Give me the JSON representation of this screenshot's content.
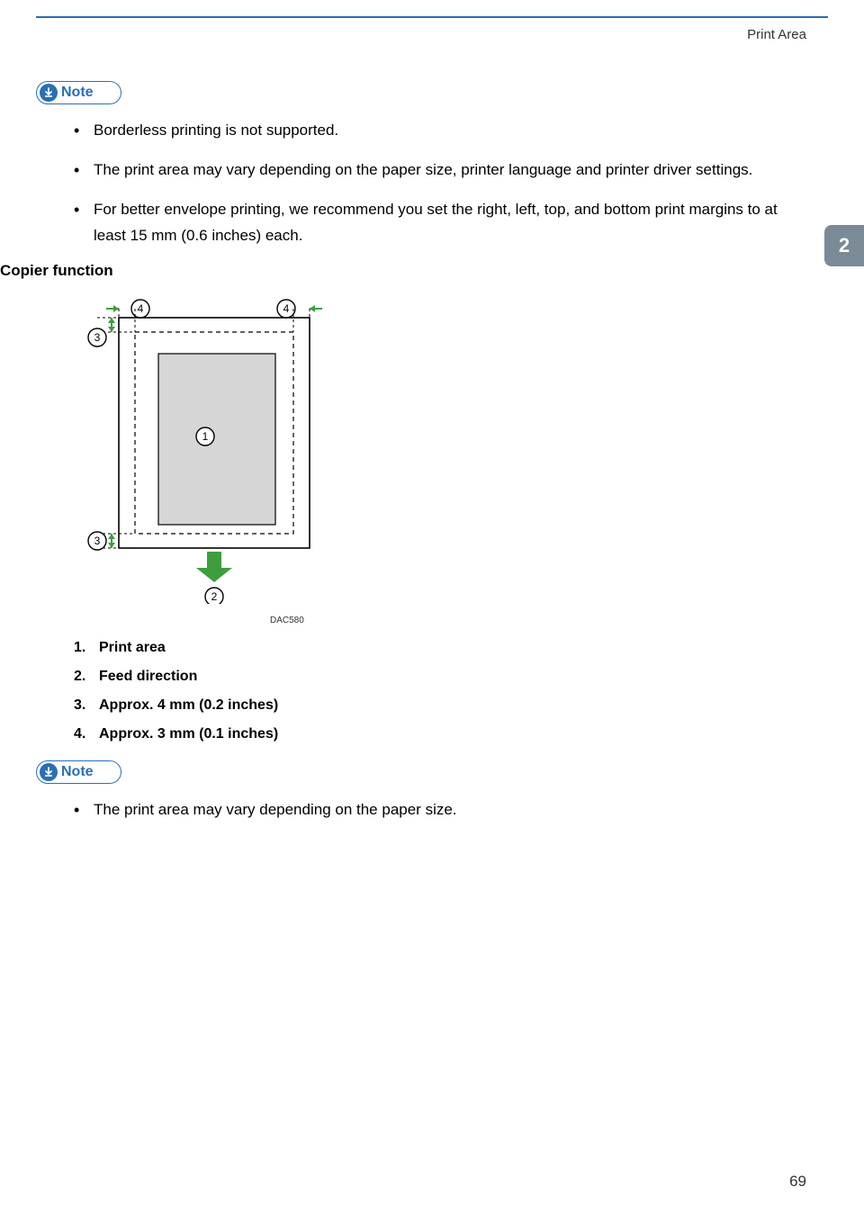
{
  "header": {
    "title": "Print Area"
  },
  "tab": {
    "label": "2"
  },
  "note_label": "Note",
  "notes_top": [
    "Borderless printing is not supported.",
    "The print area may vary depending on the paper size, printer language and printer driver settings.",
    "For better envelope printing, we recommend you set the right, left, top, and bottom print margins to at least 15 mm (0.6 inches) each."
  ],
  "section_heading": "Copier function",
  "diagram": {
    "code": "DAC580",
    "callouts": {
      "c1": "1",
      "c2": "2",
      "c3": "3",
      "c4": "4"
    }
  },
  "legend": [
    "Print area",
    "Feed direction",
    "Approx. 4 mm (0.2 inches)",
    "Approx. 3 mm (0.1 inches)"
  ],
  "notes_bottom": [
    "The print area may vary depending on the paper size."
  ],
  "page_number": "69"
}
